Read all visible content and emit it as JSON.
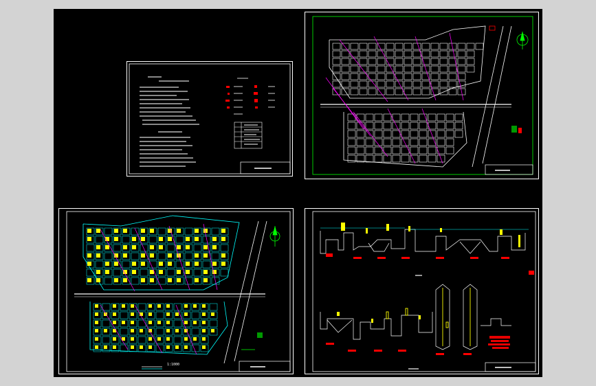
{
  "window": {
    "title": ""
  },
  "sheets": {
    "notes": {
      "title_block": ""
    },
    "pipe_plan": {
      "title_block": ""
    },
    "grid_plan": {
      "title_block": "",
      "scale_label": "1:1000"
    },
    "profile": {
      "title_block": ""
    }
  },
  "colors": {
    "workspace": "#000000",
    "frame": "#ffffff",
    "inner_frame": "#00ff00",
    "grid_white": "#ffffff",
    "grid_yellow": "#ffff00",
    "pipe_magenta": "#ff00ff",
    "road_cyan": "#00ffff",
    "mark_red": "#ff0000"
  }
}
